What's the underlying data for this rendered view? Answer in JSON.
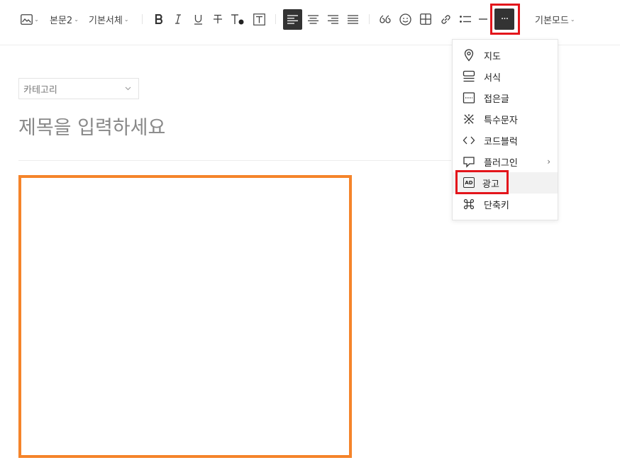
{
  "toolbar": {
    "image_icon": "image-icon",
    "paragraph_style": "본문2",
    "font": "기본서체",
    "more_icon_text": "···",
    "mode": "기본모드"
  },
  "editor": {
    "category_placeholder": "카테고리",
    "title_placeholder": "제목을 입력하세요"
  },
  "more_menu": {
    "items": [
      {
        "label": "지도",
        "icon": "map-pin-icon"
      },
      {
        "label": "서식",
        "icon": "template-icon"
      },
      {
        "label": "접은글",
        "icon": "fold-icon"
      },
      {
        "label": "특수문자",
        "icon": "special-char-icon"
      },
      {
        "label": "코드블럭",
        "icon": "code-icon"
      },
      {
        "label": "플러그인",
        "icon": "plugin-icon"
      },
      {
        "label": "광고",
        "icon": "ad-icon"
      },
      {
        "label": "단축키",
        "icon": "command-icon"
      }
    ],
    "ad_badge": "AD",
    "submenu_arrow": "›"
  },
  "colors": {
    "highlight_red": "#e3151b",
    "orange": "#f5842a",
    "active_bg": "#333333"
  }
}
